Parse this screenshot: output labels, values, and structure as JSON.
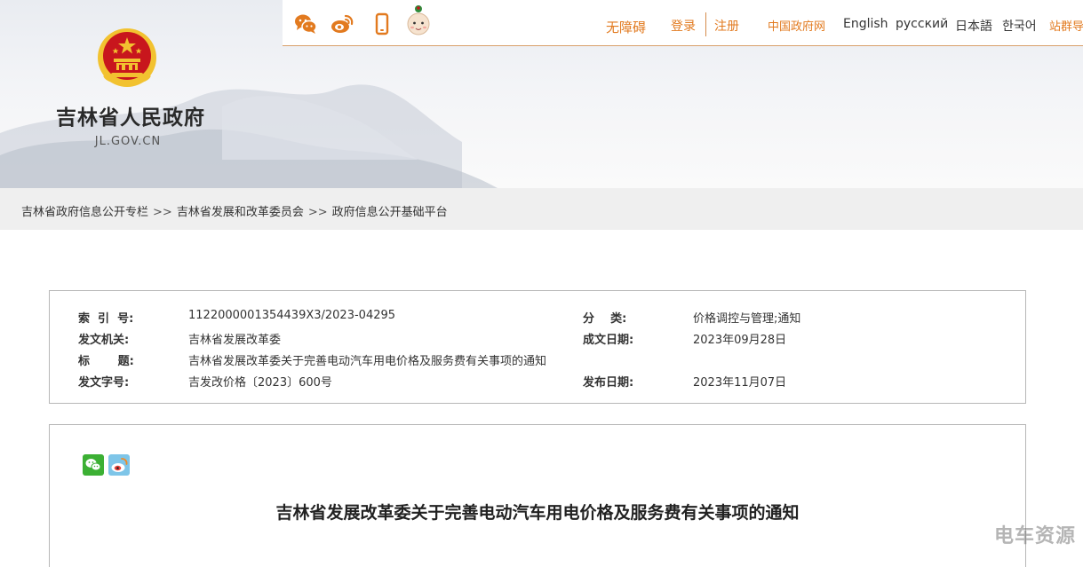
{
  "header": {
    "site_title": "吉林省人民政府",
    "site_domain": "JL.GOV.CN",
    "social_icons": [
      "wechat-icon",
      "weibo-icon",
      "mobile-icon",
      "assistant-avatar-icon"
    ],
    "accessibility": "无障碍",
    "login": "登录",
    "register": "注册",
    "languages": [
      "中国政府网",
      "English",
      "русский",
      "日本語",
      "한국어",
      "站群导航"
    ]
  },
  "breadcrumb": {
    "items": [
      "吉林省政府信息公开专栏",
      "吉林省发展和改革委员会",
      "政府信息公开基础平台"
    ],
    "separator": ">>"
  },
  "meta": {
    "index_label": "索  引  号:",
    "index_value": "1122000001354439X3/2023-04295",
    "category_label": "分    类:",
    "category_value": "价格调控与管理;通知",
    "issuer_label": "发文机关:",
    "issuer_value": "吉林省发展改革委",
    "written_label": "成文日期:",
    "written_value": "2023年09月28日",
    "title_label": "标       题:",
    "title_value": "吉林省发展改革委关于完善电动汽车用电价格及服务费有关事项的通知",
    "docno_label": "发文字号:",
    "docno_value": "吉发改价格〔2023〕600号",
    "published_label": "发布日期:",
    "published_value": "2023年11月07日"
  },
  "article": {
    "title": "吉林省发展改革委关于完善电动汽车用电价格及服务费有关事项的通知",
    "share_icons": [
      "wechat-share-icon",
      "weibo-share-icon"
    ]
  },
  "watermark": "电车资源",
  "colors": {
    "accent": "#e27a1f",
    "emblem_red": "#c8161d",
    "emblem_gold": "#f2c230"
  }
}
